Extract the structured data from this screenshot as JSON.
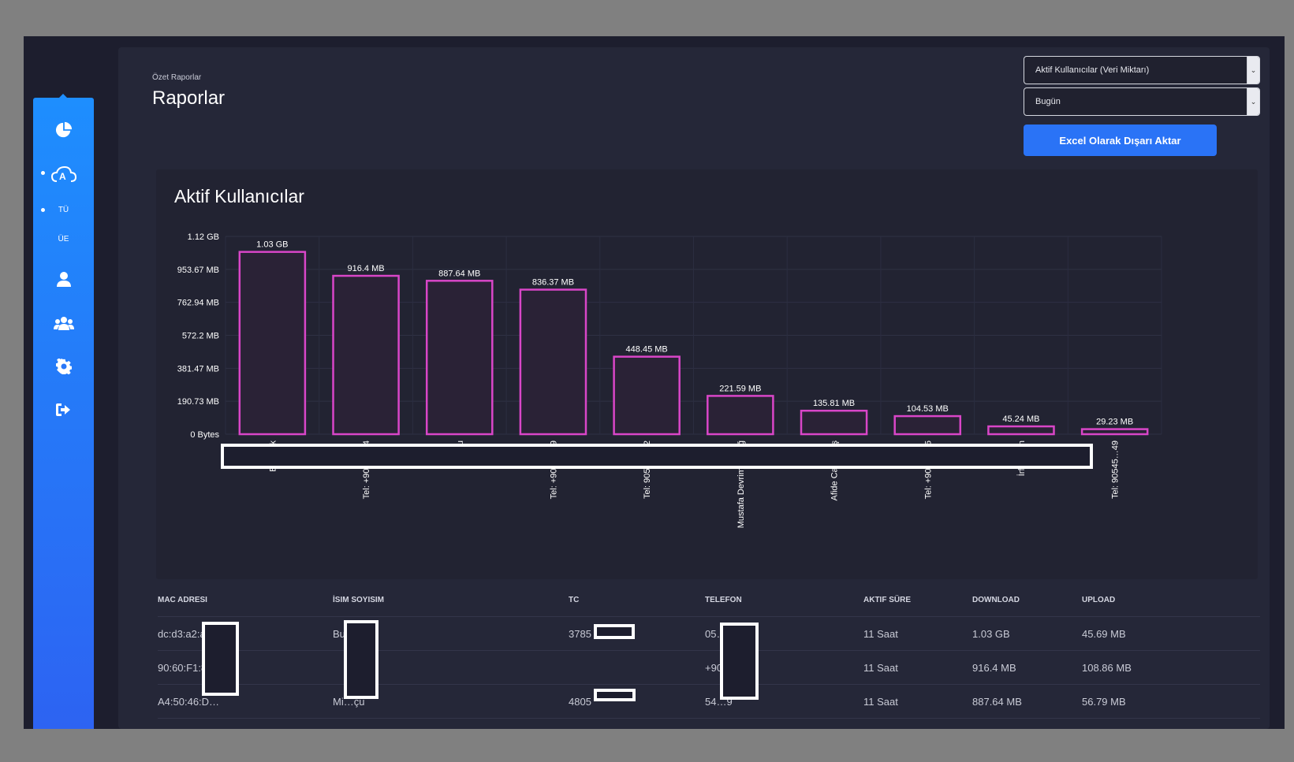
{
  "sidebar": {
    "items": [
      {
        "icon": "pie-chart-icon"
      },
      {
        "icon": "cloud-a-icon"
      },
      {
        "label": "TÜ"
      },
      {
        "label": "ÜE"
      },
      {
        "icon": "user-icon"
      },
      {
        "icon": "users-icon"
      },
      {
        "icon": "gear-icon"
      },
      {
        "icon": "sign-out-icon"
      }
    ]
  },
  "header": {
    "breadcrumb": "Özet Raporlar",
    "title": "Raporlar"
  },
  "controls": {
    "report_type": "Aktif Kullanıcılar (Veri Miktarı)",
    "period": "Bugün",
    "export_label": "Excel Olarak Dışarı Aktar"
  },
  "chart_data": {
    "type": "bar",
    "title": "Aktif Kullanıcılar",
    "y_ticks": [
      "1.12 GB",
      "953.67 MB",
      "762.94 MB",
      "572.2 MB",
      "381.47 MB",
      "190.73 MB",
      "0 Bytes"
    ],
    "ylim_mb": [
      0,
      1144.4
    ],
    "categories": [
      "Bur…ak",
      "Tel: +9054…74",
      "Mi…çu",
      "Tel: +9053…09",
      "Tel: 90536…92",
      "Mustafa Devrim U…ağ",
      "Afide Cans…aş",
      "Tel: +9054…75",
      "İrfan…an",
      "Tel: 90545…49"
    ],
    "values_mb": [
      1054.72,
      916.4,
      887.64,
      836.37,
      448.45,
      221.59,
      135.81,
      104.53,
      45.24,
      29.23
    ],
    "value_labels": [
      "1.03 GB",
      "916.4 MB",
      "887.64 MB",
      "836.37 MB",
      "448.45 MB",
      "221.59 MB",
      "135.81 MB",
      "104.53 MB",
      "45.24 MB",
      "29.23 MB"
    ],
    "bar_color": "#d946c8",
    "grid": true
  },
  "table": {
    "headers": [
      "MAC ADRESI",
      "İSIM SOYISIM",
      "TC",
      "TELEFON",
      "AKTIF SÜRE",
      "DOWNLOAD",
      "UPLOAD"
    ],
    "rows": [
      [
        "dc:d3:a2:a",
        "Bu…ak",
        "3785",
        "05…49",
        "11 Saat",
        "1.03 GB",
        "45.69 MB"
      ],
      [
        "90:60:F1:8",
        "",
        "",
        "+90…574",
        "11 Saat",
        "916.4 MB",
        "108.86 MB"
      ],
      [
        "A4:50:46:D…",
        "Mi…çu",
        "4805",
        "54…9",
        "11 Saat",
        "887.64 MB",
        "56.79 MB"
      ]
    ]
  }
}
